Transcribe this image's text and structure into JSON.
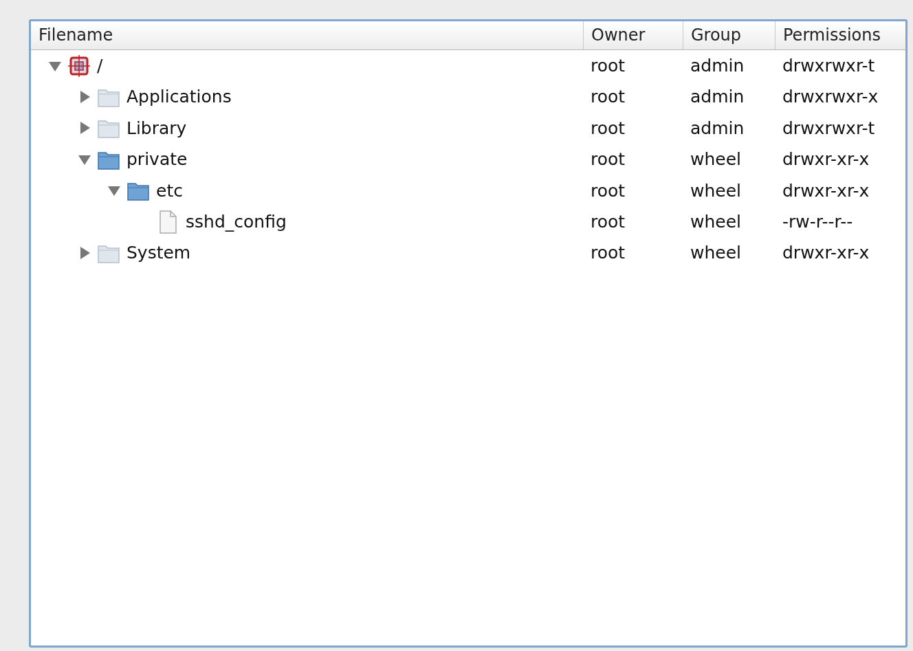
{
  "columns": [
    "Filename",
    "Owner",
    "Group",
    "Permissions"
  ],
  "rows": [
    {
      "kind": "disk",
      "name": "/",
      "owner": "root",
      "group": "admin",
      "permissions": "drwxrwxr-t",
      "expanded": true,
      "children": [
        {
          "kind": "folder",
          "name": "Applications",
          "owner": "root",
          "group": "admin",
          "permissions": "drwxrwxr-x",
          "expanded": false
        },
        {
          "kind": "folder",
          "name": "Library",
          "owner": "root",
          "group": "admin",
          "permissions": "drwxrwxr-t",
          "expanded": false
        },
        {
          "kind": "folder",
          "name": "private",
          "owner": "root",
          "group": "wheel",
          "permissions": "drwxr-xr-x",
          "expanded": true,
          "children": [
            {
              "kind": "folder",
              "name": "etc",
              "owner": "root",
              "group": "wheel",
              "permissions": "drwxr-xr-x",
              "expanded": true,
              "children": [
                {
                  "kind": "file",
                  "name": "sshd_config",
                  "owner": "root",
                  "group": "wheel",
                  "permissions": "-rw-r--r--"
                }
              ]
            }
          ]
        },
        {
          "kind": "folder",
          "name": "System",
          "owner": "root",
          "group": "wheel",
          "permissions": "drwxr-xr-x",
          "expanded": false
        }
      ]
    }
  ]
}
